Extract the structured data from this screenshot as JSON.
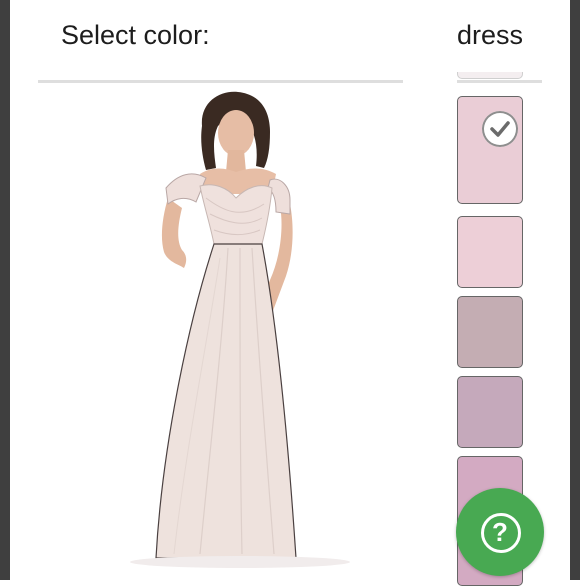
{
  "header": {
    "select_color_label": "Select color:",
    "category_label": "dress"
  },
  "swatches": [
    {
      "color": "#eacdd6",
      "selected": true
    },
    {
      "color": "#edcfd7",
      "selected": false
    },
    {
      "color": "#c4adb3",
      "selected": false
    },
    {
      "color": "#c5a9bb",
      "selected": false
    },
    {
      "color": "#d3aac2",
      "selected": false
    }
  ],
  "product_image": {
    "alt": "dress"
  },
  "help_button": {
    "glyph": "?",
    "icon": "question-mark-icon",
    "color": "#48a952"
  },
  "check_icon": "checkmark-icon"
}
